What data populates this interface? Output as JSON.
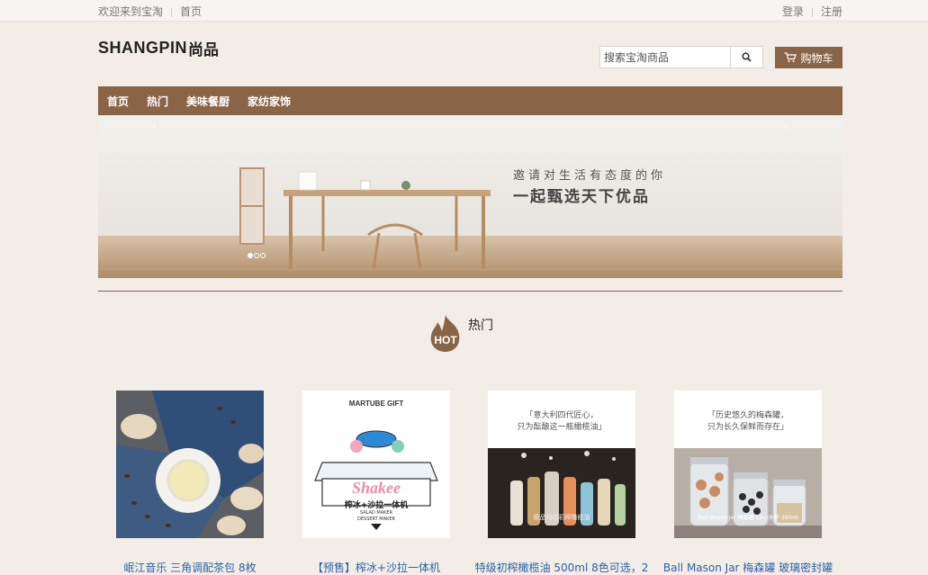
{
  "topbar": {
    "welcome": "欢迎来到宝淘",
    "home": "首页",
    "login": "登录",
    "register": "注册"
  },
  "logo": {
    "en": "SHANGPIN",
    "cn": "尚品"
  },
  "search": {
    "placeholder": "搜索宝淘商品",
    "icon": "search-icon"
  },
  "cart": {
    "label": "购物车",
    "icon": "cart-icon"
  },
  "nav": {
    "items": [
      "首页",
      "热门",
      "美味餐厨",
      "家纺家饰"
    ]
  },
  "banner": {
    "line1": "邀请对生活有态度的你",
    "line2": "一起甄选天下优品",
    "prev": "‹",
    "next": "›",
    "active_slide": 1,
    "slide_count": 3
  },
  "hot_section": {
    "badge": "HOT",
    "title": "热门"
  },
  "products": [
    {
      "name": "岷江音乐 三角调配茶包 8枚"
    },
    {
      "name": "【预售】榨冰+沙拉一体机",
      "img_text": [
        "MARTUBE GIFT",
        "Shakee",
        "榨冰+沙拉一体机",
        "SALAD MAKER",
        "DESSERT MAKER"
      ]
    },
    {
      "name": "特级初榨橄榄油 500ml 8色可选，2",
      "img_text": [
        "「意大利四代匠心，",
        "只为酝酿这一瓶橄榄油」",
        "极品特级初榨橄榄油"
      ]
    },
    {
      "name": "Ball Mason Jar 梅森罐 玻璃密封罐",
      "img_text": [
        "「历史悠久的梅森罐，",
        "只为长久保鲜而存在」",
        "Ball Mason Jar 梅森罐 12oz水杯 360ml"
      ]
    }
  ],
  "colors": {
    "brand": "#8a6446",
    "link": "#2b63a8",
    "background": "#f2ede7"
  }
}
